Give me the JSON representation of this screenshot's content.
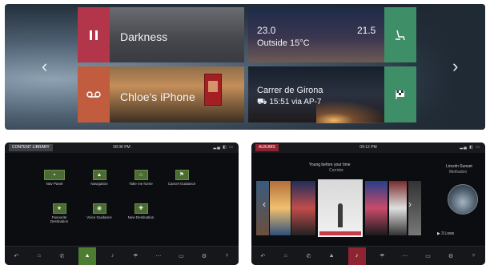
{
  "top_panel": {
    "tiles": {
      "music": {
        "title": "Darkness"
      },
      "climate": {
        "temp_left": "23.0",
        "temp_right": "21.5",
        "outside": "Outside 15°C"
      },
      "phone": {
        "title": "Chloe's iPhone"
      },
      "navigation": {
        "street": "Carrer de Girona",
        "eta": "15:51 via AP-7"
      }
    },
    "icons": {
      "prev": "chevron-left-icon",
      "next": "chevron-right-icon",
      "pause": "pause-icon",
      "voicemail": "voicemail-icon",
      "seat": "seat-icon",
      "flag": "checkered-flag-icon"
    },
    "colors": {
      "pause": "#b2354a",
      "voicemail": "#c15c3e",
      "seat": "#3e8e68",
      "flag": "#3e8e68"
    }
  },
  "screen_left": {
    "header": "CONTENT LIBRARY",
    "clock": "08:36 PM",
    "items": [
      {
        "label": "Nav Panel"
      },
      {
        "label": "Navigation"
      },
      {
        "label": "Take me home"
      },
      {
        "label": "Cancel Guidance"
      },
      {
        "label": "Favourite Destination"
      },
      {
        "label": "Voice Guidance"
      },
      {
        "label": "New Destination"
      }
    ],
    "accent": "#4d7d31"
  },
  "screen_right": {
    "header": "ALBUMS",
    "clock": "09:12 PM",
    "album_title": "Young before your time",
    "album_artist": "Corridor",
    "side_title": "Lincoln Sunset",
    "side_artist": "Methadon",
    "status": "3 Lows",
    "accent": "#8e2431"
  }
}
